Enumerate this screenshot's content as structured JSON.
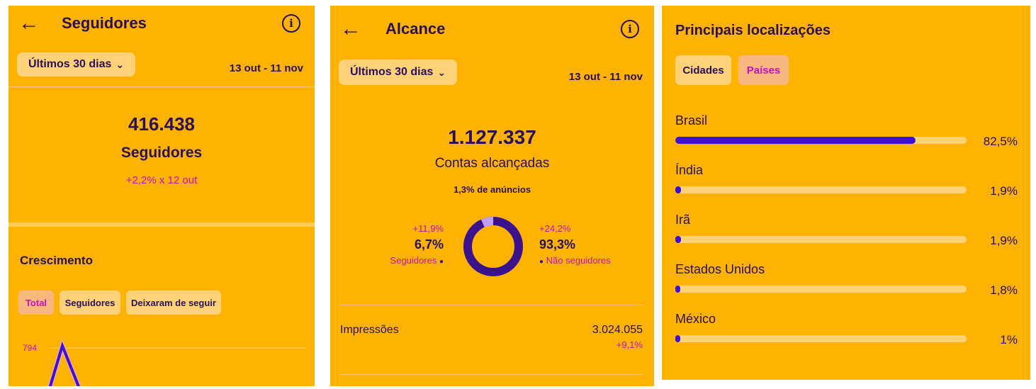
{
  "seguidores": {
    "title": "Seguidores",
    "period_label": "Últimos 30 dias",
    "date_range": "13 out - 11 nov",
    "total": "416.438",
    "total_label": "Seguidores",
    "change": "+2,2% x 12 out",
    "growth_title": "Crescimento",
    "tabs": [
      "Total",
      "Seguidores",
      "Deixaram de seguir"
    ],
    "chart_data": {
      "type": "line",
      "y_tick_label": "794",
      "peak_value": 794
    }
  },
  "alcance": {
    "title": "Alcance",
    "period_label": "Últimos 30 dias",
    "date_range": "13 out - 11 nov",
    "total": "1.127.337",
    "total_label": "Contas alcançadas",
    "ads_note": "1,3% de anúncios",
    "left": {
      "change": "+11,9%",
      "pct": "6,7%",
      "label": "Seguidores"
    },
    "right": {
      "change": "+24,2%",
      "pct": "93,3%",
      "label": "Não seguidores"
    },
    "impressions_label": "Impressões",
    "impressions_value": "3.024.055",
    "impressions_change": "+9,1%",
    "donut": {
      "followers_share": 6.7,
      "non_followers_share": 93.3
    },
    "colors": {
      "followers": "#c0a0ff",
      "non_followers": "#3a128c"
    }
  },
  "locais": {
    "title": "Principais localizações",
    "tabs": [
      "Cidades",
      "Países"
    ],
    "selected_tab": "Países",
    "items": [
      {
        "name": "Brasil",
        "pct": "82,5%",
        "value": 82.5
      },
      {
        "name": "Índia",
        "pct": "1,9%",
        "value": 1.9
      },
      {
        "name": "Irã",
        "pct": "1,9%",
        "value": 1.9
      },
      {
        "name": "Estados Unidos",
        "pct": "1,8%",
        "value": 1.8
      },
      {
        "name": "México",
        "pct": "1%",
        "value": 1
      }
    ]
  },
  "colors": {
    "background": "#ffb200",
    "accent": "#3c10d8",
    "text": "#2a0f5c",
    "highlight": "#c510c5"
  }
}
